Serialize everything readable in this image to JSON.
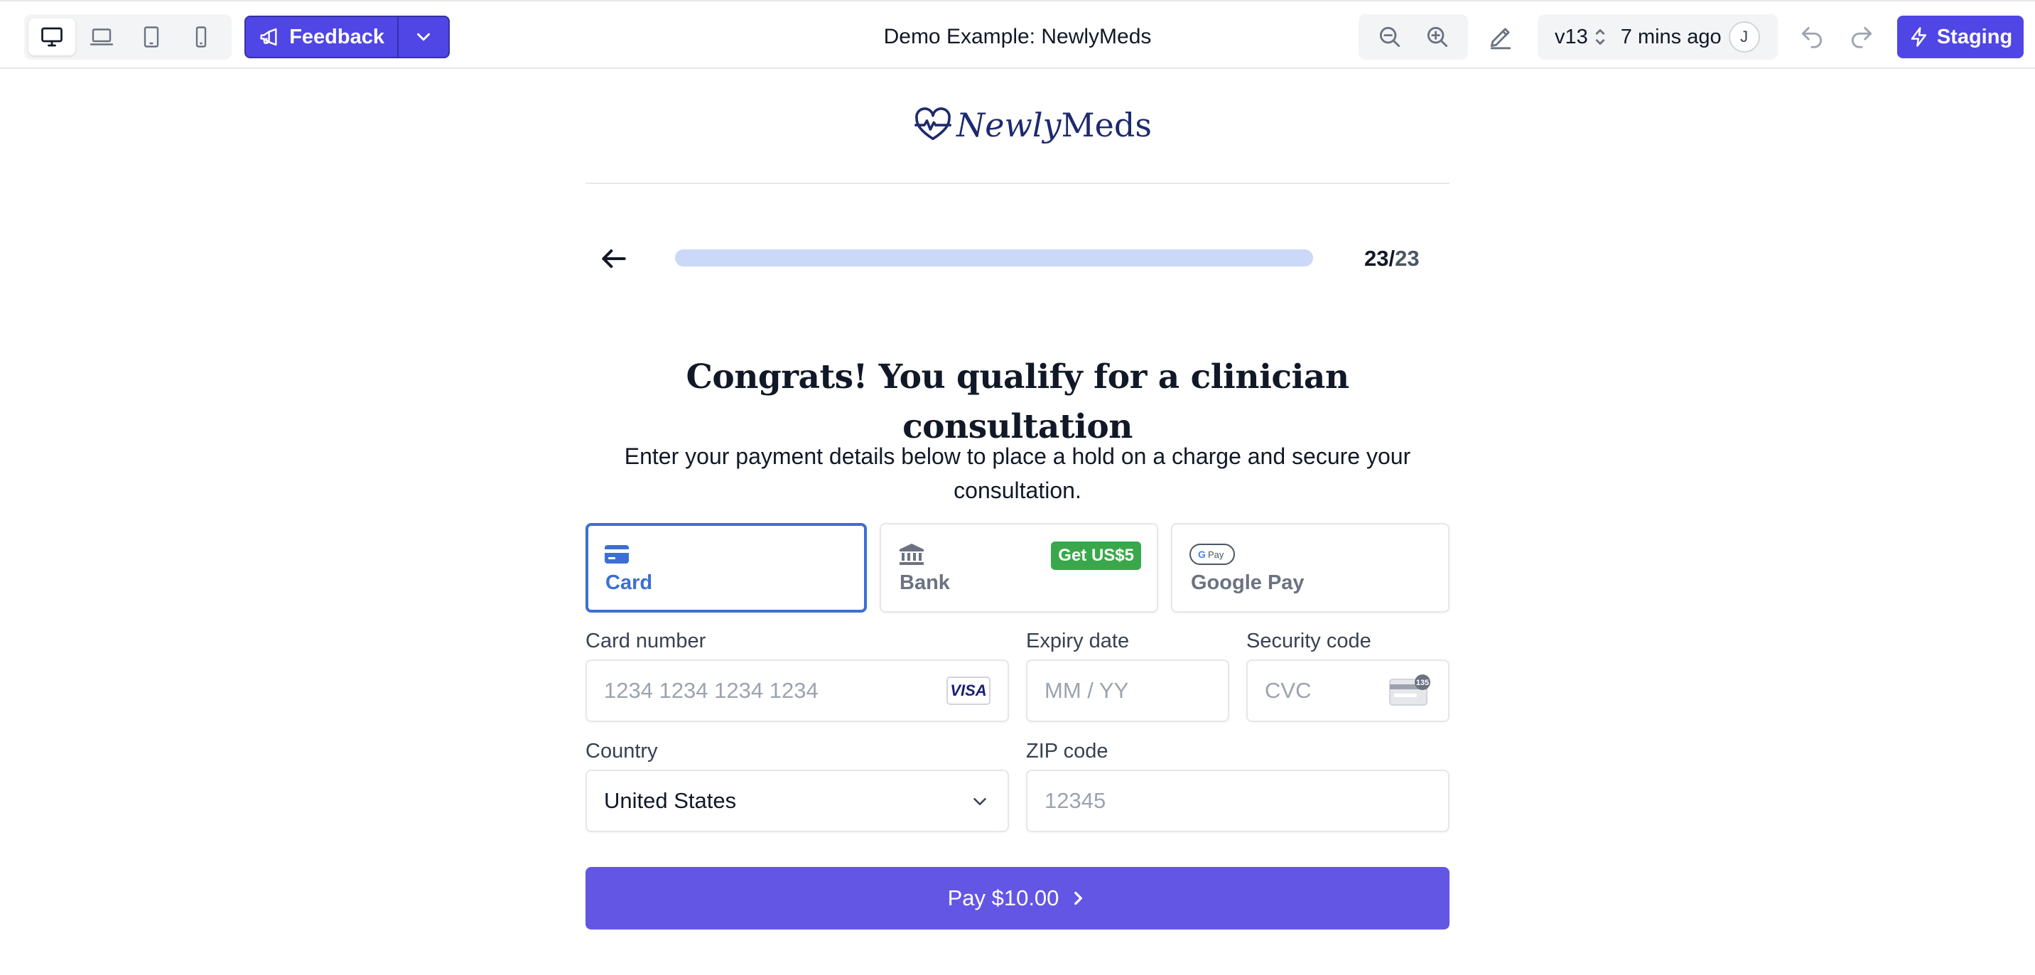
{
  "toolbar": {
    "devices": [
      {
        "name": "desktop-icon",
        "active": true
      },
      {
        "name": "laptop-icon",
        "active": false
      },
      {
        "name": "tablet-icon",
        "active": false
      },
      {
        "name": "mobile-icon",
        "active": false
      }
    ],
    "feedback_label": "Feedback",
    "title": "Demo Example: NewlyMeds",
    "version": "v13",
    "updated": "7 mins ago",
    "avatar_initial": "J",
    "staging_label": "Staging",
    "accent": "#4f46e5"
  },
  "brand": {
    "name_part1": "Newly",
    "name_part2": "Meds",
    "color": "#1e2a6e"
  },
  "progress": {
    "current": "23",
    "separator": "/",
    "total": "23",
    "fraction": 1.0
  },
  "main": {
    "headline": "Congrats! You qualify for a clinician consultation",
    "subtext": "Enter your payment details below to place a hold on a charge and secure your consultation."
  },
  "payment_methods": [
    {
      "label": "Card",
      "icon": "credit-card-icon",
      "active": true
    },
    {
      "label": "Bank",
      "icon": "bank-icon",
      "active": false,
      "badge": "Get US$5"
    },
    {
      "label": "Google Pay",
      "icon": "google-pay-icon",
      "active": false
    }
  ],
  "form": {
    "card_number": {
      "label": "Card number",
      "placeholder": "1234 1234 1234 1234",
      "brand_icon": "VISA"
    },
    "expiry": {
      "label": "Expiry date",
      "placeholder": "MM / YY"
    },
    "cvc": {
      "label": "Security code",
      "placeholder": "CVC",
      "badge": "135"
    },
    "country": {
      "label": "Country",
      "value": "United States"
    },
    "zip": {
      "label": "ZIP code",
      "placeholder": "12345"
    }
  },
  "pay_button": {
    "label": "Pay $10.00",
    "color": "#6356e5"
  }
}
